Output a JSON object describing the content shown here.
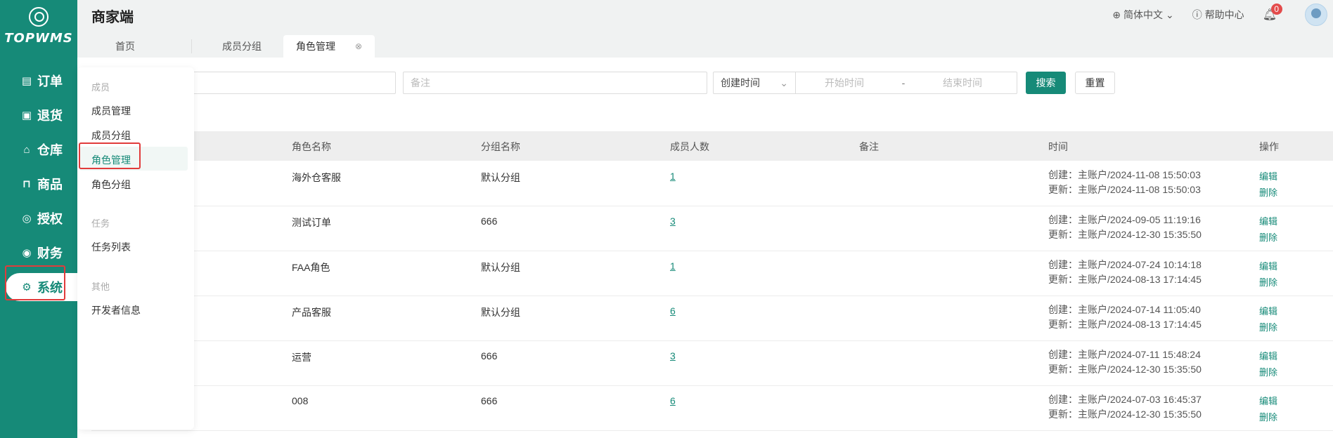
{
  "app": {
    "logo_text": "TOPWMS",
    "title": "商家端"
  },
  "sidebar": {
    "items": [
      {
        "label": "订单",
        "icon": "document-icon"
      },
      {
        "label": "退货",
        "icon": "return-icon"
      },
      {
        "label": "仓库",
        "icon": "home-icon"
      },
      {
        "label": "商品",
        "icon": "bag-icon"
      },
      {
        "label": "授权",
        "icon": "shield-icon"
      },
      {
        "label": "财务",
        "icon": "coin-icon"
      },
      {
        "label": "系统",
        "icon": "gear-icon",
        "active": true
      }
    ]
  },
  "header": {
    "language": "简体中文",
    "help": "帮助中心",
    "notifications": "0"
  },
  "tabs": [
    {
      "label": "首页"
    },
    {
      "label": "成员分组"
    },
    {
      "label": "角色管理",
      "active": true
    }
  ],
  "filters": {
    "remark_placeholder": "备注",
    "date_type": "创建时间",
    "start_placeholder": "开始时间",
    "separator": "-",
    "end_placeholder": "结束时间",
    "search_label": "搜索",
    "reset_label": "重置"
  },
  "submenu": {
    "groups": [
      {
        "title": "成员",
        "items": [
          "成员管理",
          "成员分组",
          "角色管理",
          "角色分组"
        ]
      },
      {
        "title": "任务",
        "items": [
          "任务列表"
        ]
      },
      {
        "title": "其他",
        "items": [
          "开发者信息"
        ]
      }
    ],
    "active_item": "角色管理"
  },
  "table": {
    "columns": [
      "角色名称",
      "分组名称",
      "成员人数",
      "备注",
      "时间",
      "操作"
    ],
    "rows": [
      {
        "name": "海外仓客服",
        "group": "默认分组",
        "count": "1",
        "remark": "",
        "created": "创建：主账户/2024-11-08 15:50:03",
        "updated": "更新：主账户/2024-11-08 15:50:03"
      },
      {
        "name": "测试订单",
        "group": "666",
        "count": "3",
        "remark": "",
        "created": "创建：主账户/2024-09-05 11:19:16",
        "updated": "更新：主账户/2024-12-30 15:35:50"
      },
      {
        "name": "FAA角色",
        "group": "默认分组",
        "count": "1",
        "remark": "",
        "created": "创建：主账户/2024-07-24 10:14:18",
        "updated": "更新：主账户/2024-08-13 17:14:45"
      },
      {
        "name": "产品客服",
        "group": "默认分组",
        "count": "6",
        "remark": "",
        "created": "创建：主账户/2024-07-14 11:05:40",
        "updated": "更新：主账户/2024-08-13 17:14:45"
      },
      {
        "name": "运营",
        "group": "666",
        "count": "3",
        "remark": "",
        "created": "创建：主账户/2024-07-11 15:48:24",
        "updated": "更新：主账户/2024-12-30 15:35:50"
      },
      {
        "name": "008",
        "group": "666",
        "count": "6",
        "remark": "",
        "created": "创建：主账户/2024-07-03 16:45:37",
        "updated": "更新：主账户/2024-12-30 15:35:50"
      }
    ],
    "edit_label": "编辑",
    "delete_label": "删除"
  },
  "colors": {
    "brand": "#168a78",
    "highlight": "#e13b3b",
    "badge": "#e34b4b"
  }
}
